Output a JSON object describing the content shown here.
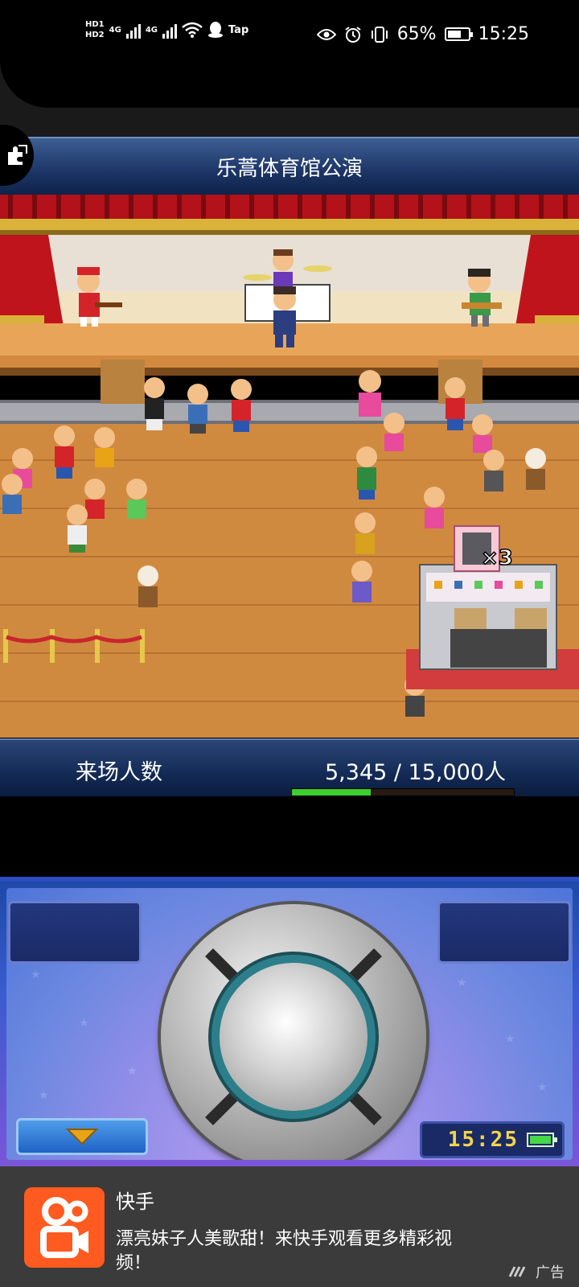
{
  "status_bar": {
    "hd1": "HD1",
    "hd2": "HD2",
    "net1": "4G",
    "net2": "4G",
    "tap_label": "Tap",
    "battery_text": "65%",
    "battery_level": 0.65,
    "time": "15:25"
  },
  "game": {
    "title": "乐蒿体育馆公演",
    "merch_count": "×3",
    "attendance_label": "来场人数",
    "attendance_value": "5,345 / 15,000人",
    "attendance_progress": 0.356
  },
  "controller": {
    "clock": "15:25",
    "accent_color": "#f2d44a"
  },
  "ad": {
    "app_name": "快手",
    "description": "漂亮妹子人美歌甜！来快手观看更多精彩视频！",
    "tag": "广告",
    "brand_color": "#ff5a1f"
  }
}
